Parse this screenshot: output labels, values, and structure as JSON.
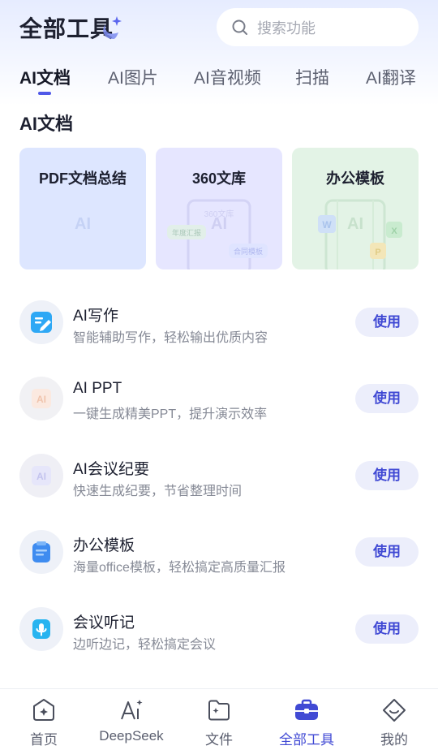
{
  "header": {
    "title": "全部工具",
    "search_placeholder": "搜索功能"
  },
  "tabs": [
    {
      "label": "AI文档",
      "active": true
    },
    {
      "label": "AI图片",
      "active": false
    },
    {
      "label": "AI音视频",
      "active": false
    },
    {
      "label": "扫描",
      "active": false
    },
    {
      "label": "AI翻译",
      "active": false
    }
  ],
  "section": {
    "title": "AI文档"
  },
  "cards": [
    {
      "label": "PDF文档总结",
      "watermark": "AI",
      "bg": "#dde6ff"
    },
    {
      "label": "360文库",
      "watermark": "AI",
      "watermark2": "360文库",
      "tag1": "年度汇报",
      "tag2": "合同模板",
      "bg": "#e6e6ff"
    },
    {
      "label": "办公模板",
      "watermark": "AI",
      "badge_w": "W",
      "badge_x": "X",
      "badge_p": "P",
      "bg": "#e3f3e6"
    }
  ],
  "tools": [
    {
      "title": "AI写作",
      "subtitle": "智能辅助写作，轻松输出优质内容",
      "button": "使用",
      "icon": "pen-doc-icon"
    },
    {
      "title": "AI PPT",
      "subtitle": "一键生成精美PPT，提升演示效率",
      "button": "使用",
      "icon": "ai-ppt-icon",
      "icon_text": "AI"
    },
    {
      "title": "AI会议纪要",
      "subtitle": "快速生成纪要，节省整理时间",
      "button": "使用",
      "icon": "ai-minutes-icon",
      "icon_text": "AI"
    },
    {
      "title": "办公模板",
      "subtitle": "海量office模板，轻松搞定高质量汇报",
      "button": "使用",
      "icon": "template-icon"
    },
    {
      "title": "会议听记",
      "subtitle": "边听边记，轻松搞定会议",
      "button": "使用",
      "icon": "microphone-icon"
    }
  ],
  "bottom_nav": [
    {
      "label": "首页",
      "icon": "home-icon",
      "active": false
    },
    {
      "label": "DeepSeek",
      "icon": "deepseek-icon",
      "active": false
    },
    {
      "label": "文件",
      "icon": "folder-icon",
      "active": false
    },
    {
      "label": "全部工具",
      "icon": "toolbox-icon",
      "active": true
    },
    {
      "label": "我的",
      "icon": "profile-icon",
      "active": false
    }
  ],
  "colors": {
    "accent": "#4049d4",
    "indicator": "#4f58e8",
    "button_bg": "#eceefb"
  }
}
